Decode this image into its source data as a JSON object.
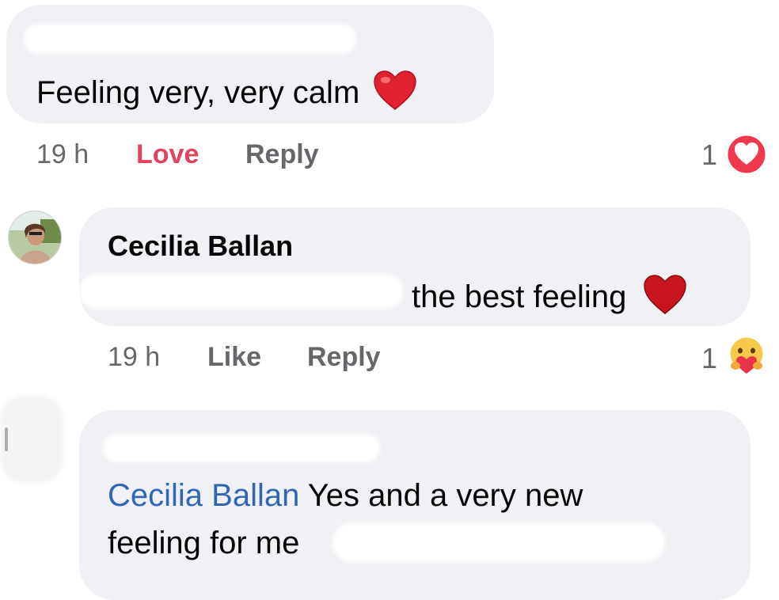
{
  "comments": [
    {
      "text": "Feeling very, very calm",
      "time": "19 h",
      "reaction_action": "Love",
      "reply_label": "Reply",
      "reaction_count": "1",
      "reaction_icon": "heart-reaction-icon",
      "emoji": "red-heart-emoji"
    },
    {
      "author": "Cecilia Ballan",
      "text": "the best feeling",
      "time": "19 h",
      "like_label": "Like",
      "reply_label": "Reply",
      "reaction_count": "1",
      "reaction_icon": "care-reaction-icon",
      "emoji": "red-heart-emoji"
    },
    {
      "mention": "Cecilia Ballan",
      "text_line1": " Yes and a very new",
      "text_line2": "feeling for me"
    }
  ],
  "colors": {
    "bubble": "#f0f1f4",
    "love": "#e0435c",
    "mention": "#2f67b5",
    "meta": "#65676b",
    "reaction_red": "#f0394e"
  }
}
